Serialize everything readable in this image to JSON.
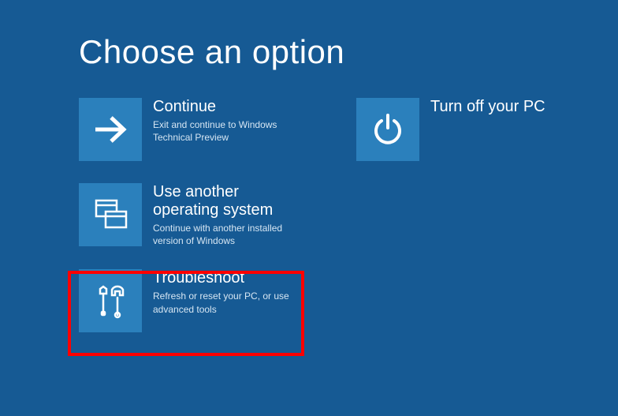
{
  "title": "Choose an option",
  "options": [
    {
      "id": "continue",
      "title": "Continue",
      "desc": "Exit and continue to Windows Technical Preview"
    },
    {
      "id": "use-another-os",
      "title": "Use another operating system",
      "desc": "Continue with another installed version of Windows"
    },
    {
      "id": "troubleshoot",
      "title": "Troubleshoot",
      "desc": "Refresh or reset your PC, or use advanced tools"
    },
    {
      "id": "turn-off",
      "title": "Turn off your PC",
      "desc": ""
    }
  ],
  "highlighted": "troubleshoot"
}
